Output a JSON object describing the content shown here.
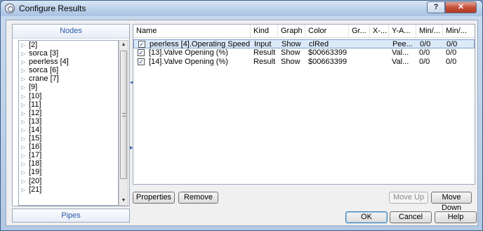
{
  "window": {
    "title": "Configure Results",
    "help_glyph": "?",
    "close_glyph": "✕"
  },
  "nodes_panel": {
    "header": "Nodes",
    "items": [
      "[2]",
      "sorca [3]",
      "peerless [4]",
      "sorca [6]",
      "crane [7]",
      "[9]",
      "[10]",
      "[11]",
      "[12]",
      "[13]",
      "[14]",
      "[15]",
      "[16]",
      "[17]",
      "[18]",
      "[19]",
      "[20]",
      "[21]"
    ]
  },
  "pipes_panel": {
    "header": "Pipes"
  },
  "grid": {
    "columns": [
      "Name",
      "Kind",
      "Graph",
      "Color",
      "Gr...",
      "X-...",
      "Y-A...",
      "Min/...",
      "Min/..."
    ],
    "rows": [
      {
        "checked": true,
        "name": "peerless [4].Operating Speed",
        "kind": "Input",
        "graph": "Show",
        "color": "clRed",
        "gr": "",
        "x": "",
        "y": "Pee...",
        "min1": "0/0",
        "min2": "0/0"
      },
      {
        "checked": true,
        "name": "[13].Valve Opening (%)",
        "kind": "Result",
        "graph": "Show",
        "color": "$00663399",
        "gr": "",
        "x": "",
        "y": "Val...",
        "min1": "0/0",
        "min2": "0/0"
      },
      {
        "checked": true,
        "name": "[14].Valve Opening (%)",
        "kind": "Result",
        "graph": "Show",
        "color": "$00663399",
        "gr": "",
        "x": "",
        "y": "Val...",
        "min1": "0/0",
        "min2": "0/0"
      }
    ]
  },
  "buttons": {
    "properties": "Properties",
    "remove": "Remove",
    "move_up": "Move Up",
    "move_down": "Move Down",
    "ok": "OK",
    "cancel": "Cancel",
    "help": "Help"
  }
}
